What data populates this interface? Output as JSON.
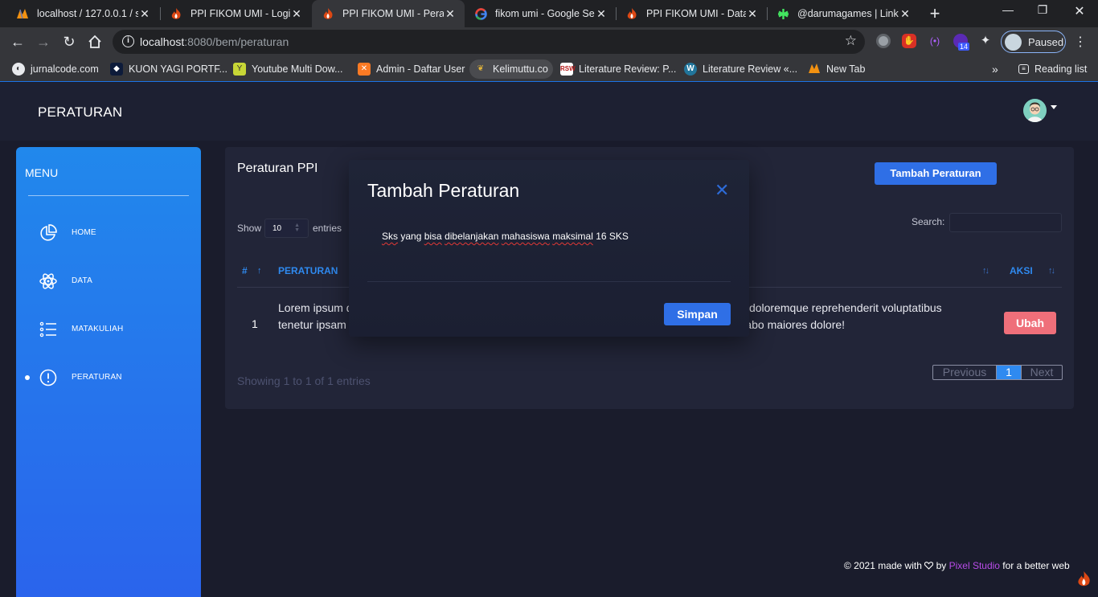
{
  "browser": {
    "tabs": [
      {
        "title": "localhost / 127.0.0.1 / s",
        "icon": "phpmyadmin-icon",
        "active": false
      },
      {
        "title": "PPI FIKOM UMI - Login",
        "icon": "codeigniter-icon",
        "active": false
      },
      {
        "title": "PPI FIKOM UMI - Peratu",
        "icon": "codeigniter-icon",
        "active": true
      },
      {
        "title": "fikom umi - Google Sea",
        "icon": "google-icon",
        "active": false
      },
      {
        "title": "PPI FIKOM UMI - Data",
        "icon": "codeigniter-icon",
        "active": false
      },
      {
        "title": "@darumagames | Linkt",
        "icon": "linktree-icon",
        "active": false
      }
    ],
    "url_host": "localhost",
    "url_port": ":8080/bem/peraturan",
    "profile_status": "Paused",
    "extension_badge": "14",
    "bookmarks": [
      {
        "label": "jurnalcode.com",
        "icon": "globe-icon"
      },
      {
        "label": "KUON YAGI PORTF...",
        "icon": "portfolio-icon"
      },
      {
        "label": "Youtube Multi Dow...",
        "icon": "y-icon"
      },
      {
        "label": "Admin - Daftar User",
        "icon": "xampp-icon"
      },
      {
        "label": "Kelimuttu.co",
        "icon": "pineapple-icon"
      },
      {
        "label": "Literature Review: P...",
        "icon": "rsw-icon"
      },
      {
        "label": "Literature Review «...",
        "icon": "wordpress-icon"
      },
      {
        "label": "New Tab",
        "icon": "phpmyadmin-icon"
      }
    ],
    "reading_list": "Reading list"
  },
  "app": {
    "page_title": "PERATURAN",
    "sidebar": {
      "title": "MENU",
      "items": [
        {
          "label": "HOME",
          "icon": "pie-chart-icon",
          "active": false
        },
        {
          "label": "DATA",
          "icon": "atom-icon",
          "active": false
        },
        {
          "label": "MATAKULIAH",
          "icon": "list-icon",
          "active": false
        },
        {
          "label": "PERATURAN",
          "icon": "alert-circle-icon",
          "active": true
        }
      ]
    },
    "card": {
      "title": "Peraturan PPI",
      "add_button": "Tambah Peraturan",
      "show_label": "Show",
      "entries_value": "10",
      "entries_label": "entries",
      "search_label": "Search:",
      "search_value": "",
      "columns": [
        "#",
        "PERATURAN",
        "AKSI"
      ],
      "rows": [
        {
          "no": "1",
          "text": "Lorem ipsum dolor sit amet consectetur adipisicing elit. Quas nesciunt dignissimos eaque nihil doloremque reprehenderit voluptatibus tenetur ipsam assumenda, quibusdam aut animi, corrupti recusandae est exceptuin iste explicabo maiores dolore!",
          "action": "Ubah"
        }
      ],
      "info": "Showing 1 to 1 of 1 entries",
      "pagination": {
        "previous": "Previous",
        "current": "1",
        "next": "Next"
      }
    },
    "modal": {
      "title": "Tambah Peraturan",
      "field_words": [
        "Sks",
        " yang ",
        "bisa",
        " ",
        "dibelanjakan",
        " ",
        "mahasiswa",
        " ",
        "maksimal",
        " 16 SKS"
      ],
      "save_button": "Simpan"
    },
    "footer": {
      "prefix": "© 2021 made with",
      "by": " by ",
      "brand": "Pixel Studio",
      "suffix": " for a better web",
      "brand_color": "#b84ce8"
    }
  }
}
